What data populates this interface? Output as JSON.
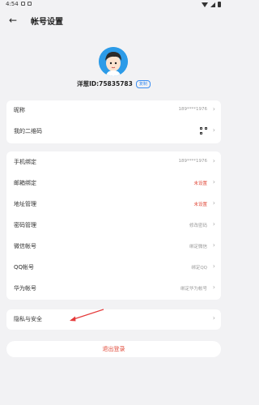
{
  "status": {
    "time": "4:54"
  },
  "header": {
    "back_icon": "arrow-left-icon",
    "title": "帐号设置"
  },
  "profile": {
    "user_id": "洋葱ID:75835783",
    "copy_label": "复制"
  },
  "card1": [
    {
      "label": "昵称",
      "value": "189****1976"
    },
    {
      "label": "我的二维码",
      "value": ""
    }
  ],
  "card2": [
    {
      "label": "手机绑定",
      "value": "189****1976",
      "red": false
    },
    {
      "label": "邮箱绑定",
      "value": "未设置",
      "red": true
    },
    {
      "label": "地址管理",
      "value": "未设置",
      "red": true
    },
    {
      "label": "密码管理",
      "value": "修改密码",
      "red": false
    },
    {
      "label": "微信帐号",
      "value": "绑定微信",
      "red": false
    },
    {
      "label": "QQ帐号",
      "value": "绑定QQ",
      "red": false
    },
    {
      "label": "华为帐号",
      "value": "绑定华为帐号",
      "red": false
    }
  ],
  "privacy": {
    "label": "隐私与安全"
  },
  "logout": {
    "label": "退出登录"
  },
  "colors": {
    "accent": "#3c8ef0",
    "danger": "#e04a3a",
    "annotation_arrow": "#e53a3a"
  }
}
